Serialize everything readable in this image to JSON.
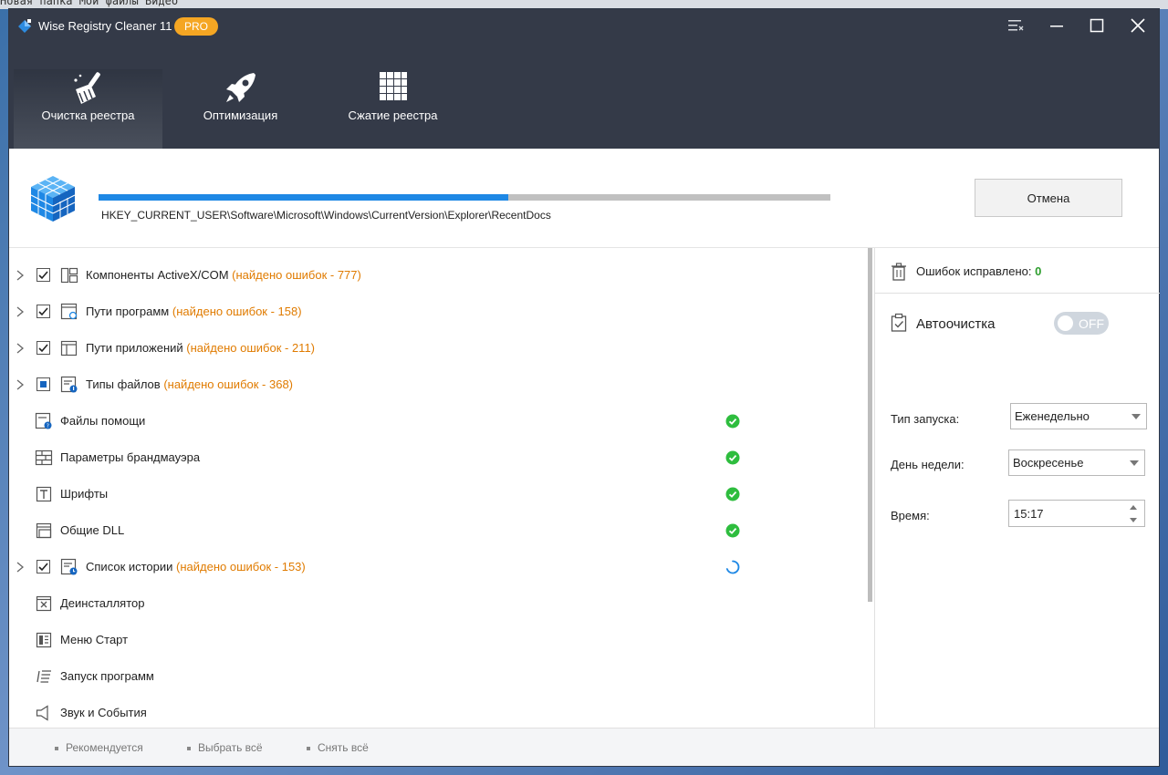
{
  "background_text": "Новая папка  Мои файлы  Видео",
  "app": {
    "title": "Wise Registry Cleaner 11",
    "badge": "PRO"
  },
  "nav": [
    {
      "label": "Очистка реестра",
      "icon": "broom-icon",
      "active": true
    },
    {
      "label": "Оптимизация",
      "icon": "rocket-icon",
      "active": false
    },
    {
      "label": "Сжатие реестра",
      "icon": "grid-icon",
      "active": false
    }
  ],
  "scan": {
    "progress_fraction": 0.56,
    "path": "HKEY_CURRENT_USER\\Software\\Microsoft\\Windows\\CurrentVersion\\Explorer\\RecentDocs",
    "cancel_label": "Отмена"
  },
  "categories": [
    {
      "label": "Компоненты ActiveX/COM",
      "found": "(найдено ошибок - 777)"
    },
    {
      "label": "Пути программ",
      "found": "(найдено ошибок - 158)"
    },
    {
      "label": "Пути приложений",
      "found": "(найдено ошибок - 211)"
    },
    {
      "label": "Типы файлов",
      "found": "(найдено ошибок - 368)"
    },
    {
      "label": "Файлы помощи",
      "found": ""
    },
    {
      "label": "Параметры брандмауэра",
      "found": ""
    },
    {
      "label": "Шрифты",
      "found": ""
    },
    {
      "label": "Общие DLL",
      "found": ""
    },
    {
      "label": "Список истории",
      "found": "(найдено ошибок - 153)"
    },
    {
      "label": "Деинсталлятор",
      "found": ""
    },
    {
      "label": "Меню Старт",
      "found": ""
    },
    {
      "label": "Запуск программ",
      "found": ""
    },
    {
      "label": "Звук и События",
      "found": ""
    }
  ],
  "right": {
    "fixed_label": "Ошибок исправлено:",
    "fixed_count": "0",
    "auto_label": "Автоочистка",
    "toggle_state": "OFF",
    "launch_type_label": "Тип запуска:",
    "launch_type_value": "Еженедельно",
    "weekday_label": "День недели:",
    "weekday_value": "Воскресенье",
    "time_label": "Время:",
    "time_value": "15:17"
  },
  "footer": {
    "recommended": "Рекомендуется",
    "select_all": "Выбрать всё",
    "deselect_all": "Снять всё"
  },
  "colors": {
    "header_bg": "#343a48",
    "accent_blue": "#1e88e5",
    "found_orange": "#e07b00",
    "ok_green": "#2ecc40",
    "badge_orange": "#f5a623"
  }
}
